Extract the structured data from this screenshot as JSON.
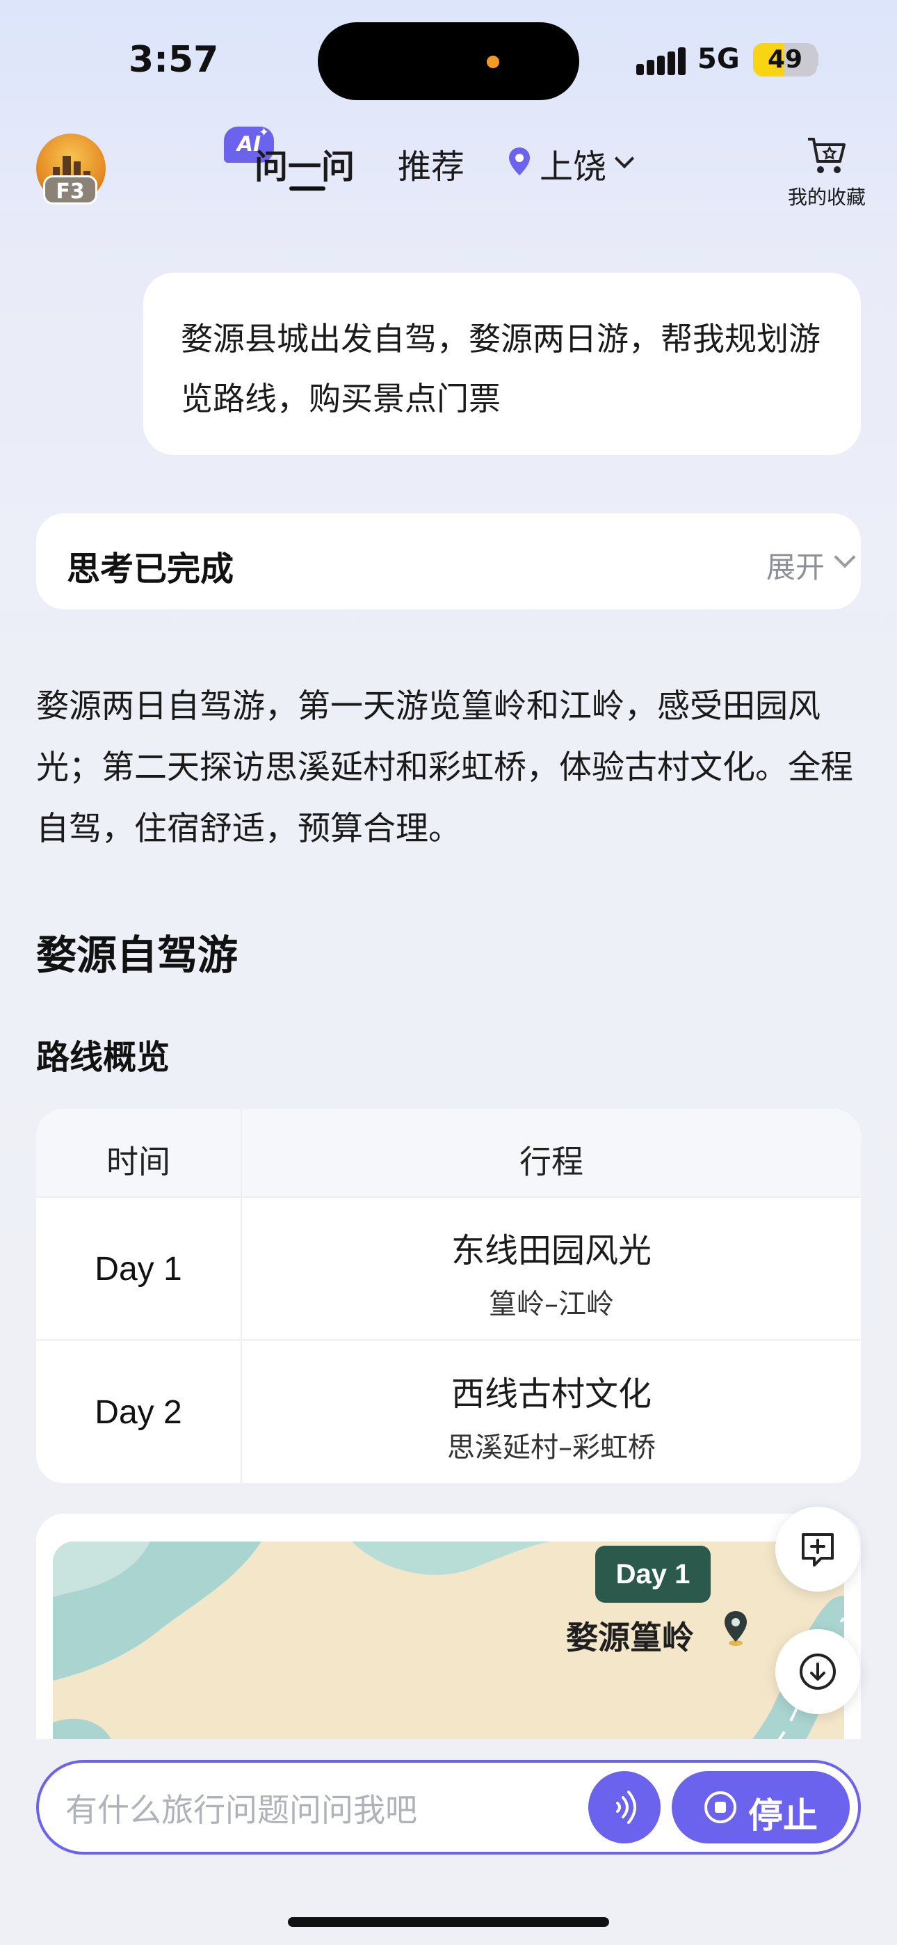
{
  "status_bar": {
    "time": "3:57",
    "network": "5G",
    "battery": "49",
    "battery_level": 0.49
  },
  "header": {
    "avatar_badge": "F3",
    "ai_badge": "AI",
    "tabs": [
      {
        "label": "问一问",
        "active": true
      },
      {
        "label": "推荐",
        "active": false
      }
    ],
    "location": "上饶",
    "favorites_label": "我的收藏"
  },
  "chat": {
    "user_message": "婺源县城出发自驾，婺源两日游，帮我规划游览路线，购买景点门票",
    "thinking": {
      "title": "思考已完成",
      "toggle_label": "展开"
    },
    "answer_summary": "婺源两日自驾游，第一天游览篁岭和江岭，感受田园风光；第二天探访思溪延村和彩虹桥，体验古村文化。全程自驾，住宿舒适，预算合理。",
    "section_title": "婺源自驾游",
    "route_overview_title": "路线概览",
    "table": {
      "headers": [
        "时间",
        "行程"
      ],
      "rows": [
        {
          "day": "Day 1",
          "theme": "东线田园风光",
          "route": "篁岭–江岭"
        },
        {
          "day": "Day 2",
          "theme": "西线古村文化",
          "route": "思溪延村–彩虹桥"
        }
      ]
    },
    "map_card": {
      "day_tag": "Day 1",
      "place": "婺源篁岭"
    }
  },
  "input": {
    "placeholder": "有什么旅行问题问问我吧",
    "stop_label": "停止"
  },
  "colors": {
    "accent": "#6b62ee",
    "day_tag": "#2b5a4c",
    "map_water": "#a9d4d0",
    "map_land": "#f3e6c9"
  }
}
